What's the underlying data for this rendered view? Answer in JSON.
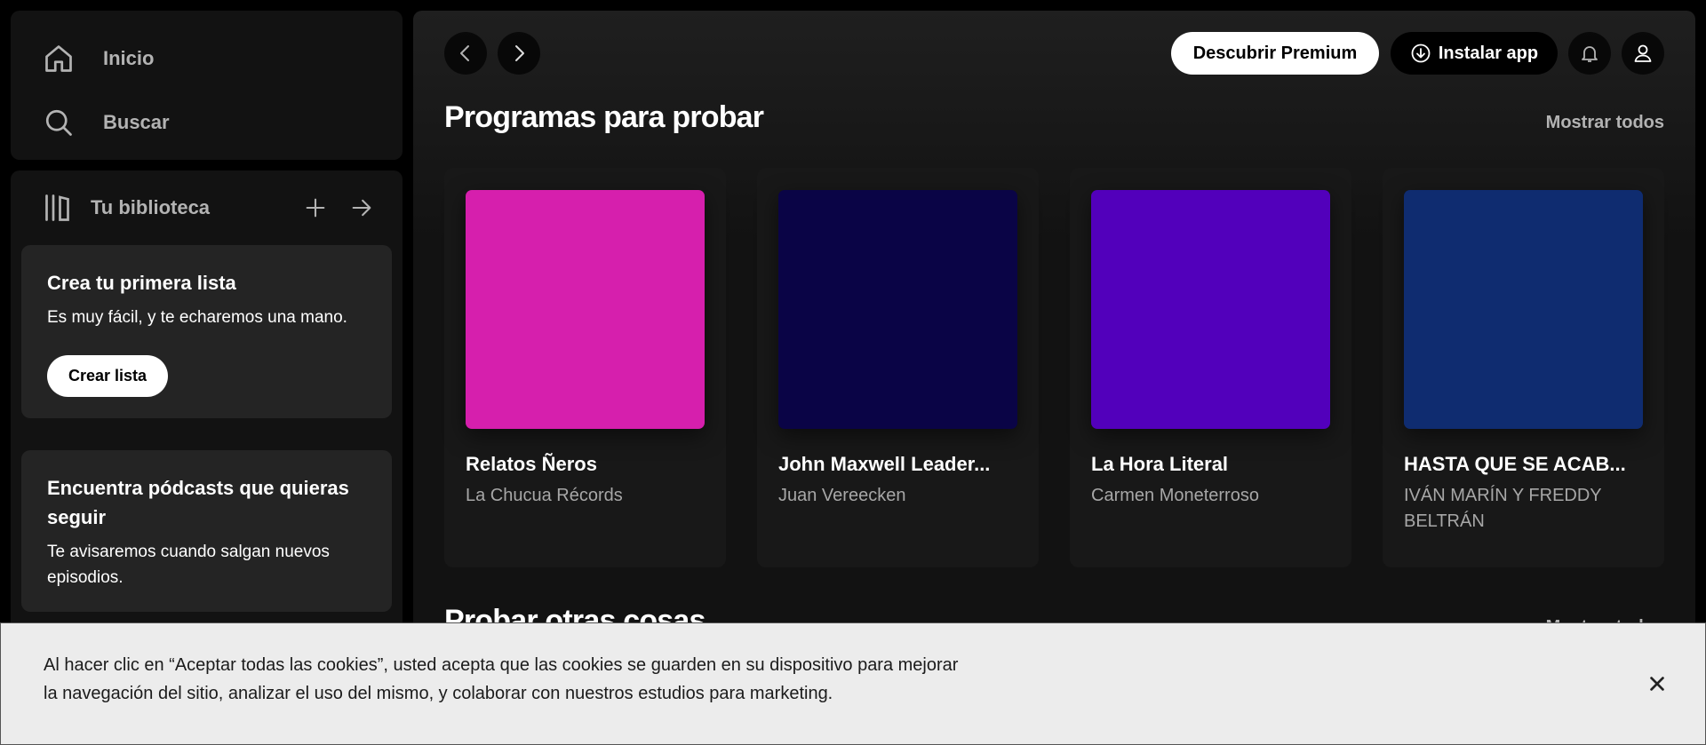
{
  "sidebar": {
    "nav": [
      {
        "label": "Inicio",
        "icon": "home-icon"
      },
      {
        "label": "Buscar",
        "icon": "search-icon"
      }
    ],
    "library": {
      "title": "Tu biblioteca",
      "promos": [
        {
          "title": "Crea tu primera lista",
          "text": "Es muy fácil, y te echaremos una mano.",
          "button": "Crear lista"
        },
        {
          "title": "Encuentra pódcasts que quieras seguir",
          "text": "Te avisaremos cuando salgan nuevos episodios."
        }
      ]
    }
  },
  "header": {
    "premium_label": "Descubrir Premium",
    "install_label": "Instalar app"
  },
  "main": {
    "section_title": "Programas para probar",
    "show_all": "Mostrar todos",
    "cards": [
      {
        "title": "Relatos Ñeros",
        "subtitle": "La Chucua Récords",
        "color": "#d61fad"
      },
      {
        "title": "John Maxwell Leader...",
        "subtitle": "Juan Vereecken",
        "color": "#0a0446"
      },
      {
        "title": "La Hora Literal",
        "subtitle": "Carmen Moneterroso",
        "color": "#5200bb"
      },
      {
        "title": "HASTA QUE SE ACAB...",
        "subtitle": "IVÁN MARÍN Y FREDDY BELTRÁN",
        "color": "#0f2c70"
      }
    ],
    "section2_title": "Probar otras cosas",
    "section2_show_all": "Mostrar todos"
  },
  "cookie_banner": {
    "text": "Al hacer clic en “Aceptar todas las cookies”, usted acepta que las cookies se guarden en su dispositivo para mejorar la navegación del sitio, analizar el uso del mismo, y colaborar con nuestros estudios para marketing."
  }
}
